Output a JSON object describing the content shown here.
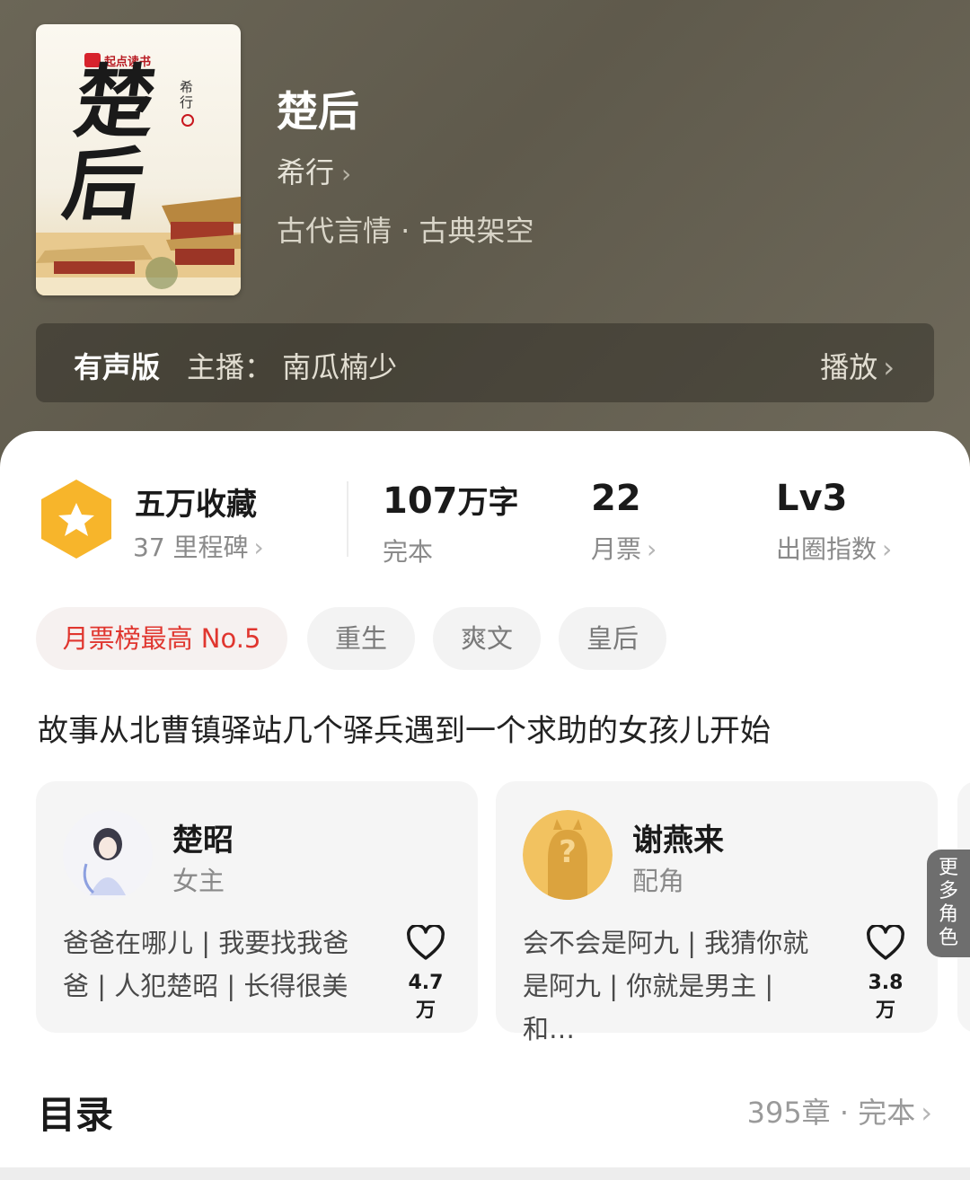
{
  "cover": {
    "logo_text": "起点读书",
    "big_title": "楚后",
    "author_vertical": "希行"
  },
  "book": {
    "title": "楚后",
    "author": "希行",
    "category": "古代言情 · 古典架空"
  },
  "audio": {
    "label": "有声版",
    "host": "主播：  南瓜楠少",
    "play": "播放"
  },
  "stats": {
    "favorites": "五万收藏",
    "milestones": "37 里程碑",
    "words_value": "107",
    "words_unit": "万字",
    "words_status": "完本",
    "monthly_votes": "22",
    "monthly_votes_label": "月票",
    "level": "Lv3",
    "level_label": "出圈指数"
  },
  "tags": [
    "月票榜最高 No.5",
    "重生",
    "爽文",
    "皇后"
  ],
  "description": "故事从北曹镇驿站几个驿兵遇到一个求助的女孩儿开始",
  "roles": [
    {
      "name": "楚昭",
      "type": "女主",
      "quote": "爸爸在哪儿 | 我要找我爸爸 | 人犯楚昭 | 长得很美",
      "likes": "4.7万"
    },
    {
      "name": "谢燕来",
      "type": "配角",
      "quote": "会不会是阿九 | 我猜你就是阿九 | 你就是男主 | 和…",
      "likes": "3.8万"
    }
  ],
  "more_roles": "更多角色",
  "toc": {
    "title": "目录",
    "info": "395章 · 完本"
  },
  "colors": {
    "accent": "#e0362f",
    "badge": "#f7b52b",
    "header": "#66614f"
  }
}
